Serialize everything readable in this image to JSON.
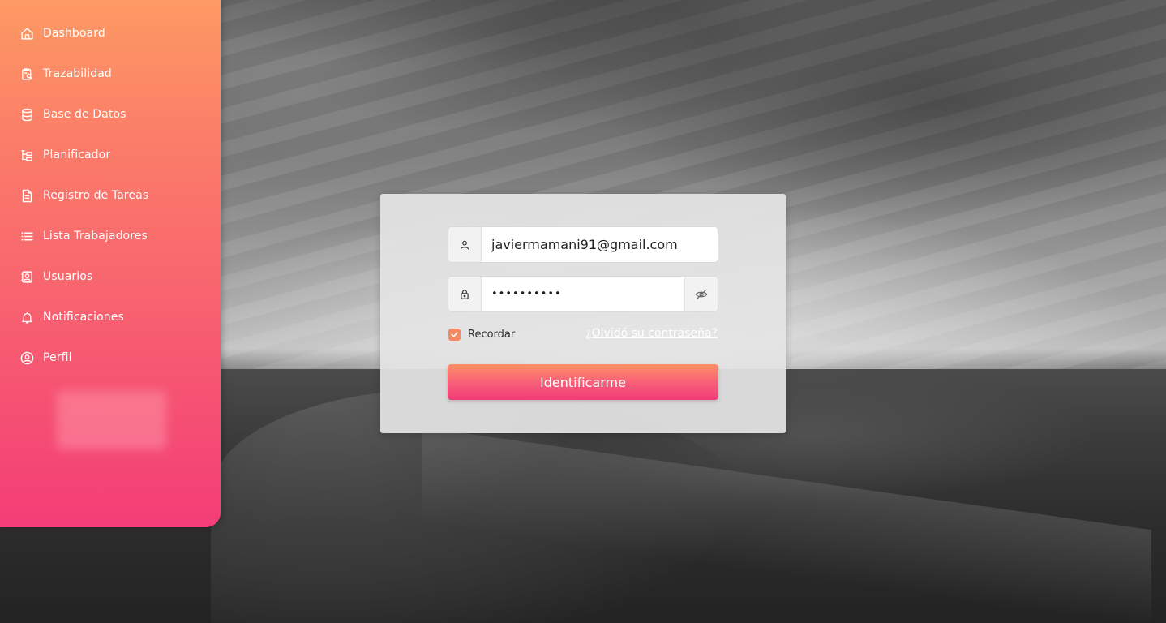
{
  "sidebar": {
    "items": [
      {
        "label": "Dashboard",
        "icon": "home-icon"
      },
      {
        "label": "Trazabilidad",
        "icon": "clipboard-search-icon"
      },
      {
        "label": "Base de Datos",
        "icon": "database-icon"
      },
      {
        "label": "Planificador",
        "icon": "tree-list-icon"
      },
      {
        "label": "Registro de Tareas",
        "icon": "document-icon"
      },
      {
        "label": "Lista Trabajadores",
        "icon": "list-icon"
      },
      {
        "label": "Usuarios",
        "icon": "contacts-icon"
      },
      {
        "label": "Notificaciones",
        "icon": "bell-icon"
      },
      {
        "label": "Perfil",
        "icon": "user-circle-icon"
      }
    ],
    "gradient_top": "#fd9a63",
    "gradient_bottom": "#f33d77"
  },
  "login": {
    "email_value": "javiermamani91@gmail.com",
    "password_value": "••••••••••",
    "remember_label": "Recordar",
    "remember_checked": true,
    "forgot_label": "¿Olvidó su contraseña?",
    "submit_label": "Identificarme",
    "accent": "#f38a63"
  }
}
